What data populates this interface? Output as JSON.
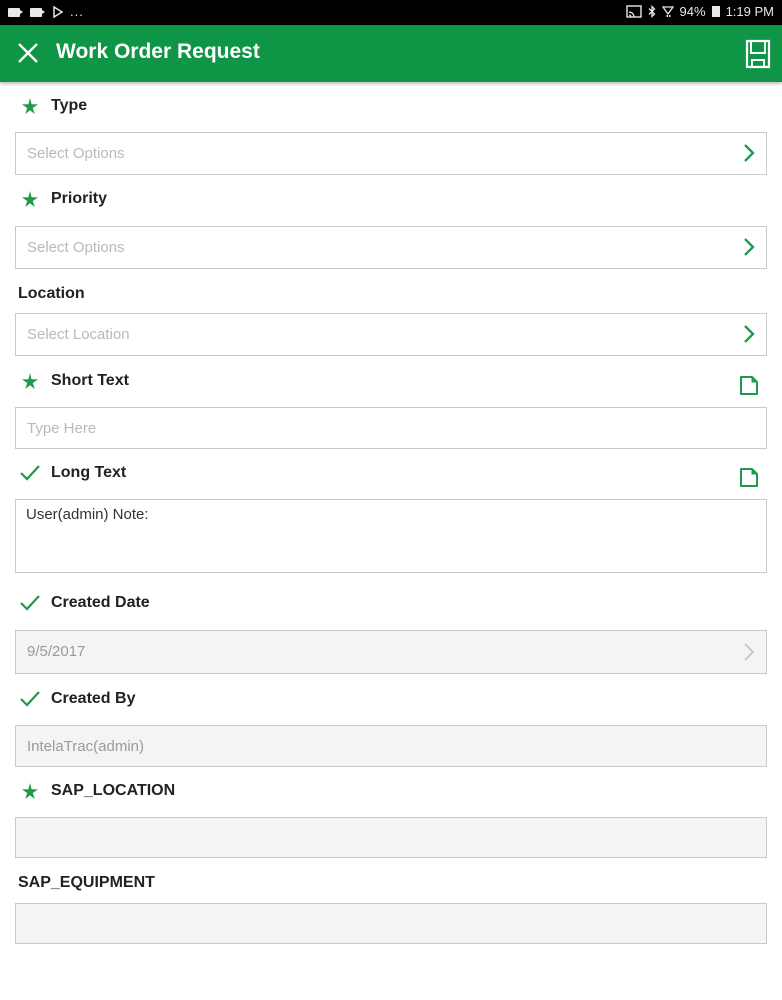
{
  "status_bar": {
    "left_icons": [
      "video-notification-icon",
      "video-notification-icon",
      "play-store-icon"
    ],
    "overflow": "...",
    "right_icons": [
      "cast-icon",
      "bluetooth-icon",
      "wifi-icon"
    ],
    "battery": "94%",
    "time": "1:19 PM"
  },
  "app_bar": {
    "close_icon": "close-icon",
    "title": "Work Order Request",
    "save_icon": "save-icon"
  },
  "colors": {
    "brand_green": "#0f9546",
    "required_star": "#1f9a4a",
    "check": "#1f9a4a",
    "placeholder": "#b9b9b9",
    "border": "#c9c9c9",
    "readonly_bg": "#f4f4f4"
  },
  "form": {
    "type": {
      "label": "Type",
      "marker": "required-star",
      "placeholder": "Select Options"
    },
    "priority": {
      "label": "Priority",
      "marker": "required-star",
      "placeholder": "Select Options"
    },
    "location": {
      "label": "Location",
      "marker": "none",
      "placeholder": "Select Location"
    },
    "short_text": {
      "label": "Short Text",
      "marker": "required-star",
      "placeholder": "Type Here",
      "action_icon": "document-icon"
    },
    "long_text": {
      "label": "Long Text",
      "marker": "check",
      "value": "User(admin) Note:",
      "action_icon": "document-icon"
    },
    "created_date": {
      "label": "Created Date",
      "marker": "check",
      "value": "9/5/2017"
    },
    "created_by": {
      "label": "Created By",
      "marker": "check",
      "value": "IntelaTrac(admin)"
    },
    "sap_location": {
      "label": "SAP_LOCATION",
      "marker": "required-star",
      "value": ""
    },
    "sap_equipment": {
      "label": "SAP_EQUIPMENT",
      "marker": "none",
      "value": ""
    }
  }
}
